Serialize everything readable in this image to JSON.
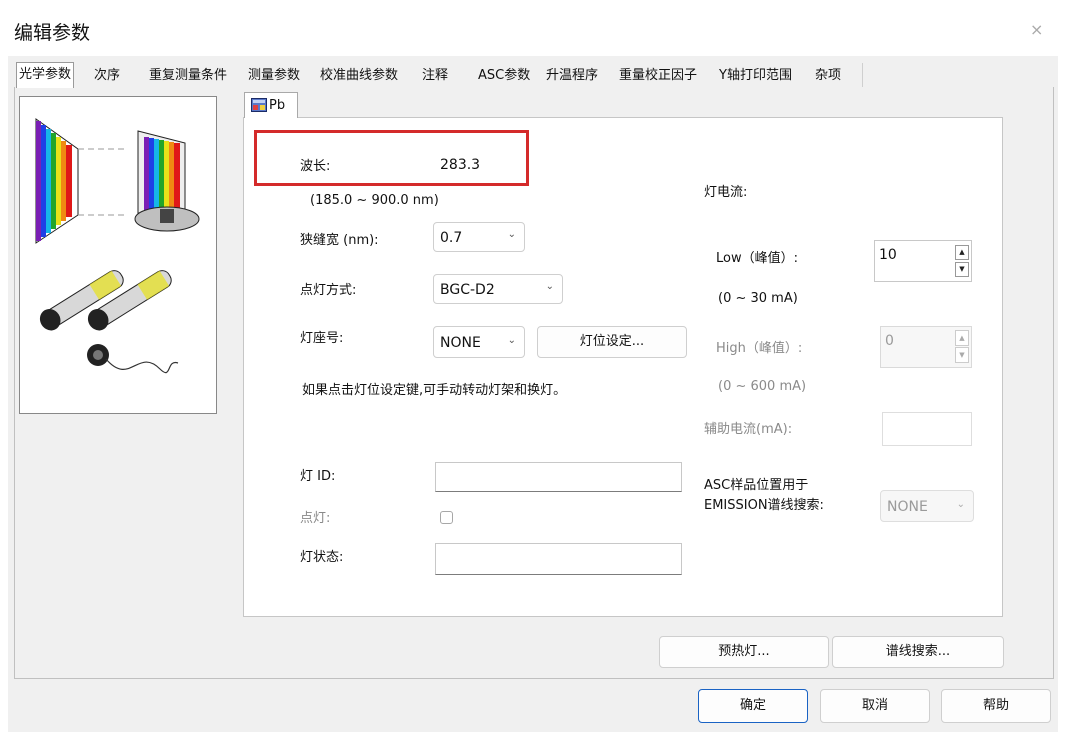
{
  "window": {
    "title": "编辑参数",
    "close_glyph": "×"
  },
  "tabs": [
    {
      "label": "光学参数",
      "active": true
    },
    {
      "label": "次序"
    },
    {
      "label": "重复测量条件"
    },
    {
      "label": "测量参数"
    },
    {
      "label": "校准曲线参数"
    },
    {
      "label": "注释"
    },
    {
      "label": "ASC参数"
    },
    {
      "label": "升温程序"
    },
    {
      "label": "重量校正因子"
    },
    {
      "label": "Y轴打印范围"
    },
    {
      "label": "杂项"
    }
  ],
  "element_tab": {
    "label": "Pb"
  },
  "form": {
    "wavelength_label": "波长:",
    "wavelength_value": "283.3",
    "wavelength_range": "(185.0 ~ 900.0 nm)",
    "slit_label": "狭缝宽 (nm):",
    "slit_value": "0.7",
    "lamp_mode_label": "点灯方式:",
    "lamp_mode_value": "BGC-D2",
    "socket_label": "灯座号:",
    "socket_value": "NONE",
    "socket_button": "灯位设定...",
    "hint": "如果点击灯位设定键,可手动转动灯架和换灯。",
    "lamp_id_label": "灯 ID:",
    "lamp_id_value": "",
    "light_label": "点灯:",
    "lamp_state_label": "灯状态:",
    "lamp_state_value": ""
  },
  "current": {
    "section_label": "灯电流:",
    "low_label": "Low（峰值）:",
    "low_value": "10",
    "low_range": "(0 ~ 30 mA)",
    "high_label": "High（峰值）:",
    "high_value": "0",
    "high_range": "(0 ~ 600 mA)",
    "aux_label": "辅助电流(mA):",
    "asc_label_1": "ASC样品位置用于",
    "asc_label_2": "EMISSION谱线搜索:",
    "asc_value": "NONE"
  },
  "actions": {
    "preheat": "预热灯...",
    "line_search": "谱线搜索...",
    "ok": "确定",
    "cancel": "取消",
    "help": "帮助"
  },
  "colors": {
    "highlight": "#d42a2a",
    "primary_border": "#1a63c4"
  }
}
